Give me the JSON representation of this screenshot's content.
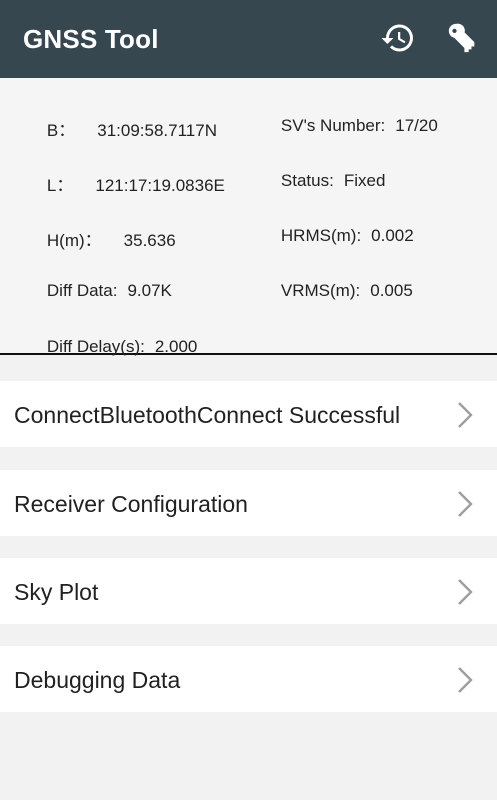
{
  "app": {
    "title": "GNSS Tool",
    "icons": [
      "history-icon",
      "key-icon"
    ],
    "colors": {
      "appbar": "#37474f",
      "chevron": "#9e9e9e"
    }
  },
  "status": {
    "b": {
      "label": "B：",
      "value": "31:09:58.7117N"
    },
    "l": {
      "label": "L：",
      "value": "121:17:19.0836E"
    },
    "h": {
      "label": "H(m)：",
      "value": "35.636"
    },
    "diff_data": {
      "label": "Diff Data:",
      "value": "9.07K"
    },
    "diff_delay": {
      "label": "Diff Delay(s):",
      "value": "2.000"
    },
    "sv_number": {
      "label": "SV's Number:",
      "value": "17/20"
    },
    "state": {
      "label": "Status:",
      "value": "Fixed"
    },
    "hrms": {
      "label": "HRMS(m):",
      "value": "0.002"
    },
    "vrms": {
      "label": "VRMS(m):",
      "value": "0.005"
    }
  },
  "menu": [
    {
      "label": "ConnectBluetoothConnect Successful"
    },
    {
      "label": "Receiver Configuration"
    },
    {
      "label": "Sky Plot"
    },
    {
      "label": "Debugging Data"
    }
  ]
}
